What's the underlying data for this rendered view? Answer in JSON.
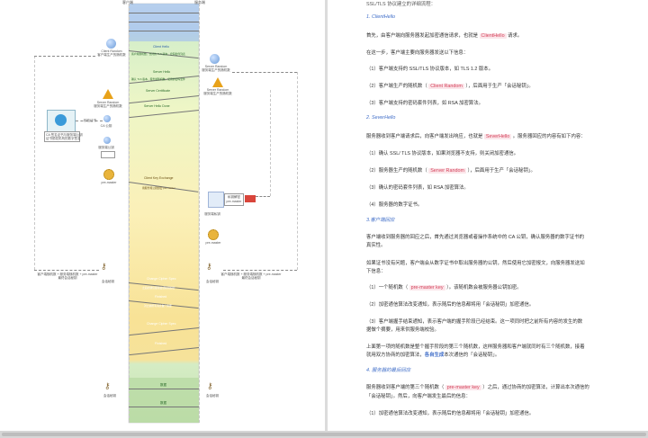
{
  "diagram": {
    "col_client": "客户端",
    "col_server": "服务端",
    "client_random_label": "Client Random\n客户端生产的随机数",
    "server_random_label": "Server Random\n服务端生产的随机数",
    "server_random_label2": "Server Random\n服务端生产的随机数",
    "verify_label": "校验证书",
    "ca_label": "CA 公钥",
    "cert_text": "CA 签名证书与服务端公钥\n证书颁发机构的数字签名",
    "pubkey_label": "服务端公钥",
    "pre_master_left": "pre-master",
    "pre_master_right": "pre-master",
    "pre_master_right2": "pre-master",
    "session_key_left": "客户端随机数 + 服务端随机数 + pre-master\n最终会话秘钥",
    "session_key_right": "客户端随机数 + 服务端随机数 + pre-master\n最终会话秘钥",
    "session_key_sub": "会话秘钥",
    "decrypt_label": "私钥解密",
    "private_key_label": "服务端私钥",
    "client_hello": "Client Hello",
    "client_hello_sub": "客户端随机数，支持的 TLS 版本，密码套件列表",
    "server_hello": "Server Hello",
    "server_hello_sub": "确认 TLS 版本，服务端随机数，使用的密码套件",
    "server_certificate": "Server Certificate",
    "server_hello_done": "Server Hello Done",
    "client_key_exchange": "Client Key Exchange",
    "client_key_exchange_sub": "用服务端公钥加密 pre-master",
    "change_cipher_spec": "Change Cipher Spec",
    "change_cipher_spec_sub": "之后的通信都用会话秘钥加密",
    "finished": "Finished",
    "finished_sub": "对之前所有消息做个摘要",
    "change_cipher_spec_2": "Change Cipher Spec",
    "finished_2": "Finished",
    "data_label": "数据",
    "data_label_2": "数据"
  },
  "doc": {
    "top_cut": "SSL/TLS 协议建立的详细流程：",
    "s1_title": "1. ClientHello",
    "s1_p1_a": "首先，由客户端向服务器发起加密通信请求，也就是",
    "s1_p1_hl": "ClientHello",
    "s1_p1_b": "请求。",
    "s1_p2": "在这一步，客户端主要向服务器发送以下信息：",
    "s1_i1": "（1）客户端支持的 SSL/TLS 协议版本，如 TLS 1.2 版本。",
    "s1_i2_a": "（2）客户端生产的随机数（",
    "s1_i2_hl": "Client Random",
    "s1_i2_b": "），后面用于生产「会话秘钥」。",
    "s1_i3": "（3）客户端支持的密码套件列表，如 RSA 加密算法。",
    "s2_title": "2. SeverHello",
    "s2_p1_a": "服务器收到客户端请求后，向客户端发出响应，也就是",
    "s2_p1_hl": "SeverHello",
    "s2_p1_b": "。服务器回应的内容有如下内容：",
    "s2_i1": "（1）确认 SSL/ TLS 协议版本，如果浏览器不支持，则关闭加密通信。",
    "s2_i2_a": "（2）服务器生产的随机数（",
    "s2_i2_hl": "Server Random",
    "s2_i2_b": "），后面用于生产「会话秘钥」。",
    "s2_i3": "（3）确认的密码套件列表，如 RSA 加密算法。",
    "s2_i4": "（4）服务器的数字证书。",
    "s3_title": "3.客户端回应",
    "s3_p1_l1": "客户端收到服务器的回应之后，首先通过浏览器或者操作系统中的 CA 公钥，确认服务器的数字证书的",
    "s3_p1_l2": "真实性。",
    "s3_p2_l1": "如果证书没有问题，客户端会从数字证书中取出服务器的公钥，然后使用它加密报文，向服务器发送如",
    "s3_p2_l2": "下信息：",
    "s3_i1_a": "（1）一个随机数（",
    "s3_i1_hl": "pre-master key",
    "s3_i1_b": "）。该随机数会被服务器公钥加密。",
    "s3_i2": "（2）加密通信算法改变通知，表示随后的信息都将用「会话秘钥」加密通信。",
    "s3_i3_l1": "（3）客户端握手结束通知，表示客户端的握手阶段已经结束。这一项同时把之前所有内容的发生的数",
    "s3_i3_l2": "据做个摘要，用来供服务端校验。",
    "s3_p3_l1": "上面第一项的随机数是整个握手阶段的第三个随机数，这样服务器和客户端就同时有三个随机数，接着",
    "s3_p3_l2a": "就用双方协商的加密算法，",
    "s3_p3_l2_link": "各自生成",
    "s3_p3_l2b": "本次通信的「会话秘钥」。",
    "s4_title": "4. 服务器的最后回应",
    "s4_p1_a": "服务器收到客户端的第三个随机数（",
    "s4_p1_hl": "pre-master key",
    "s4_p1_b": "）之后，通过协商的加密算法，计算出本次通信的",
    "s4_p1_l2": "「会话秘钥」。然后，向客户端发生最后的信息：",
    "s4_i1": "（1）加密通信算法改变通知，表示随后的信息都将用「会话秘钥」加密通信。"
  },
  "colors": {
    "heading_blue": "#3f6dc8",
    "highlight_red": "#d43f58",
    "band_blue": "#9dbde6",
    "band_green": "#b7d9a3",
    "band_yellow": "#f9e9a8"
  }
}
